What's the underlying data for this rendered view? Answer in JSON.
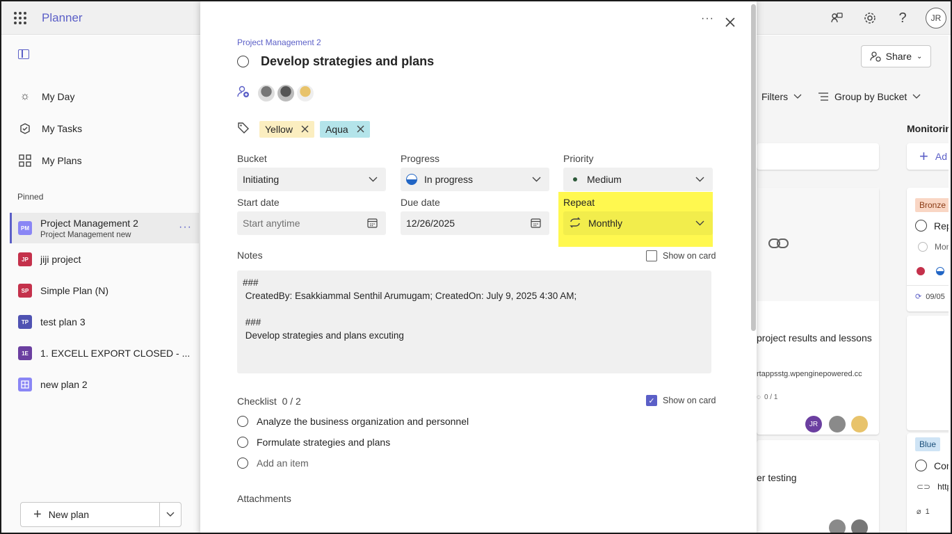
{
  "app": {
    "name": "Planner",
    "user_initials": "JR"
  },
  "topbar": {
    "icons": [
      "chat-feedback-icon",
      "gear-icon",
      "help-icon"
    ]
  },
  "sidebar": {
    "nav": [
      {
        "label": "My Day",
        "icon": "sun-icon"
      },
      {
        "label": "My Tasks",
        "icon": "task-icon"
      },
      {
        "label": "My Plans",
        "icon": "grid-icon"
      }
    ],
    "pinned_label": "Pinned",
    "plans": [
      {
        "badge": "PM",
        "label": "Project Management 2",
        "sub": "Project Management new",
        "color": "#8a86f5",
        "selected": true
      },
      {
        "badge": "JP",
        "label": "jiji project",
        "color": "#c4314b"
      },
      {
        "badge": "SP",
        "label": "Simple Plan (N)",
        "color": "#c4314b"
      },
      {
        "badge": "TP",
        "label": "test plan 3",
        "color": "#4f52b2"
      },
      {
        "badge": "1E",
        "label": "1. EXCELL EXPORT CLOSED - ...",
        "color": "#6b3fa0"
      },
      {
        "badge": "",
        "label": "new plan 2",
        "color": "#8a86f5"
      }
    ],
    "new_plan": "New plan"
  },
  "board": {
    "share": "Share",
    "filters": "Filters",
    "group_by": "Group by Bucket",
    "bucket_title": "Monitoring",
    "add_task": "Ad",
    "card1": {
      "title": "project results and lessons",
      "link": "rtappsstg.wpenginepowered.cc",
      "checklist": "0 / 1",
      "avatar": "JR"
    },
    "card2": {
      "title": "er testing"
    },
    "col2": {
      "tag": "Bronze",
      "task1": "Repo",
      "task2": "Mon",
      "date": "09/05",
      "tag2": "Blue",
      "task3": "Cond",
      "link": "https",
      "attach": "1"
    }
  },
  "dialog": {
    "plan_name": "Project Management 2",
    "title": "Develop strategies and plans",
    "labels": [
      {
        "name": "Yellow",
        "bg": "#fbeec0"
      },
      {
        "name": "Aqua",
        "bg": "#b4e4ea"
      }
    ],
    "bucket": {
      "label": "Bucket",
      "value": "Initiating"
    },
    "progress": {
      "label": "Progress",
      "value": "In progress"
    },
    "priority": {
      "label": "Priority",
      "value": "Medium"
    },
    "start": {
      "label": "Start date",
      "placeholder": "Start anytime"
    },
    "due": {
      "label": "Due date",
      "value": "12/26/2025"
    },
    "repeat": {
      "label": "Repeat",
      "value": "Monthly"
    },
    "notes": {
      "label": "Notes",
      "show_on_card": "Show on card",
      "text": "###\n CreatedBy: Esakkiammal Senthil Arumugam; CreatedOn: July 9, 2025 4:30 AM;\n\n ###\n Develop strategies and plans excuting"
    },
    "checklist": {
      "label": "Checklist",
      "count": "0 / 2",
      "show_on_card": "Show on card",
      "items": [
        "Analyze the business organization and personnel",
        "Formulate strategies and plans"
      ],
      "add": "Add an item"
    },
    "attachments": "Attachments"
  }
}
